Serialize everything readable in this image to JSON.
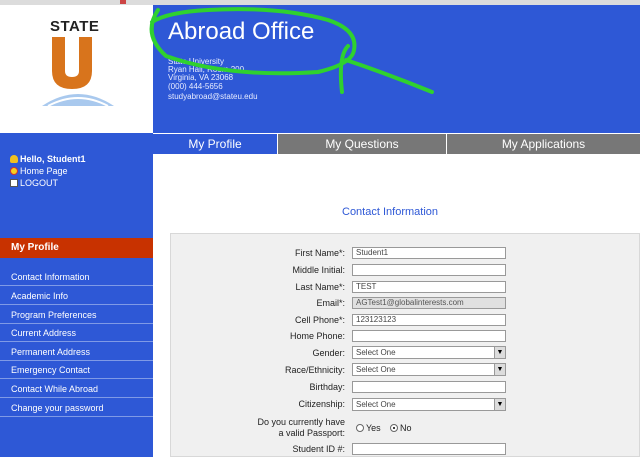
{
  "logo": {
    "state": "STATE",
    "letter": "U"
  },
  "header": {
    "title": "Abroad Office",
    "address_lines": [
      "State University",
      "Ryan Hall, Room 200",
      "Virginia, VA 23068",
      "(000) 444-5656",
      "studyabroad@stateu.edu"
    ]
  },
  "user_links": [
    {
      "label": "Hello, Student1",
      "icon": "person-icon"
    },
    {
      "label": "Home Page",
      "icon": "home-icon"
    },
    {
      "label": "LOGOUT",
      "icon": "logout-icon"
    }
  ],
  "sidebar": {
    "heading": "My Profile",
    "items": [
      "Contact Information",
      "Academic Info",
      "Program Preferences",
      "Current Address",
      "Permanent Address",
      "Emergency Contact",
      "Contact While Abroad",
      "Change your password"
    ]
  },
  "tabs": [
    "My Profile",
    "My Questions",
    "My Applications"
  ],
  "contact_title": "Contact Information",
  "form": {
    "first_name": {
      "label": "First Name*:",
      "value": "Student1"
    },
    "middle_initial": {
      "label": "Middle Initial:",
      "value": ""
    },
    "last_name": {
      "label": "Last Name*:",
      "value": "TEST"
    },
    "email": {
      "label": "Email*:",
      "value": "AGTest1@globalinterests.com"
    },
    "cell_phone": {
      "label": "Cell Phone*:",
      "value": "123123123"
    },
    "home_phone": {
      "label": "Home Phone:",
      "value": ""
    },
    "gender": {
      "label": "Gender:",
      "value": "Select One"
    },
    "race": {
      "label": "Race/Ethnicity:",
      "value": "Select One"
    },
    "birthday": {
      "label": "Birthday:",
      "value": ""
    },
    "citizenship": {
      "label": "Citizenship:",
      "value": "Select One"
    },
    "passport": {
      "label_line1": "Do you currently have",
      "label_line2": "a valid Passport:",
      "yes": "Yes",
      "no": "No",
      "selected": "No"
    },
    "student_id": {
      "label": "Student ID #:",
      "value": ""
    }
  },
  "colors": {
    "header_blue": "#2e58d6",
    "active_red": "#c83200",
    "tab_gray": "#777777",
    "annotation_green": "#2fd12f",
    "logo_orange": "#d8741c"
  }
}
